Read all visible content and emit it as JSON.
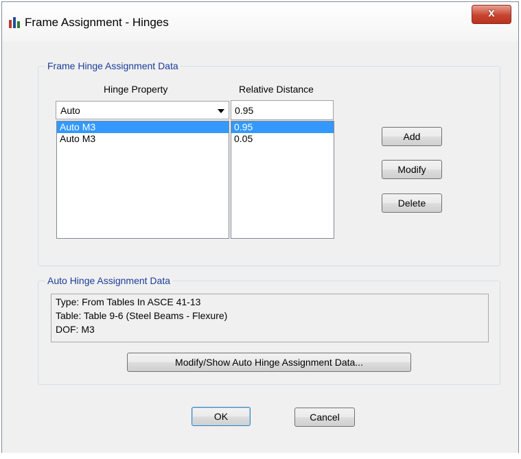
{
  "window": {
    "title": "Frame Assignment - Hinges",
    "close_label": "x"
  },
  "frame_group": {
    "title": "Frame Hinge Assignment Data",
    "hinge_property_header": "Hinge Property",
    "relative_distance_header": "Relative Distance",
    "hinge_property_value": "Auto",
    "relative_distance_value": "0.95",
    "hinge_list": [
      "Auto  M3",
      "Auto  M3"
    ],
    "distance_list": [
      "0.95",
      "0.05"
    ],
    "add_label": "Add",
    "modify_label": "Modify",
    "delete_label": "Delete"
  },
  "auto_group": {
    "title": "Auto Hinge Assignment Data",
    "type_line": "Type:  From Tables In ASCE 41-13",
    "table_line": "Table:  Table 9-6 (Steel Beams - Flexure)",
    "dof_line": "DOF:  M3",
    "modify_show_label": "Modify/Show Auto Hinge Assignment Data..."
  },
  "footer": {
    "ok_label": "OK",
    "cancel_label": "Cancel"
  }
}
